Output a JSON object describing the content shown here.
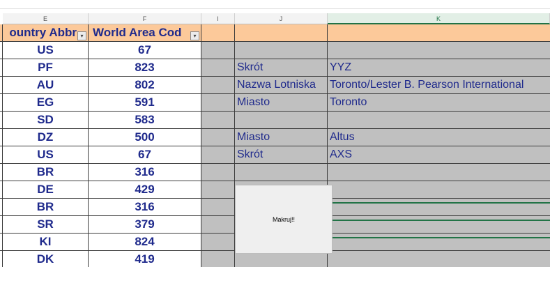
{
  "columns": [
    "E",
    "F",
    "I",
    "J",
    "K"
  ],
  "headers": {
    "country_abbr": "ountry Abbr",
    "world_area_code": "World Area Cod",
    "filter_glyph": "▾"
  },
  "rows": [
    {
      "e": "US",
      "f": "67",
      "j": "",
      "k": ""
    },
    {
      "e": "PF",
      "f": "823",
      "j": "Skrót",
      "k": "YYZ"
    },
    {
      "e": "AU",
      "f": "802",
      "j": "Nazwa Lotniska",
      "k": "Toronto/Lester B. Pearson International"
    },
    {
      "e": "EG",
      "f": "591",
      "j": "Miasto",
      "k": "Toronto"
    },
    {
      "e": "SD",
      "f": "583",
      "j": "",
      "k": ""
    },
    {
      "e": "DZ",
      "f": "500",
      "j": "Miasto",
      "k": "Altus"
    },
    {
      "e": "US",
      "f": "67",
      "j": "Skrót",
      "k": "AXS"
    },
    {
      "e": "BR",
      "f": "316",
      "j": "",
      "k": ""
    },
    {
      "e": "DE",
      "f": "429",
      "j": "",
      "k": ""
    },
    {
      "e": "BR",
      "f": "316",
      "j": "",
      "k": ""
    },
    {
      "e": "SR",
      "f": "379",
      "j": "",
      "k": ""
    },
    {
      "e": "KI",
      "f": "824",
      "j": "",
      "k": ""
    },
    {
      "e": "DK",
      "f": "419",
      "j": "",
      "k": ""
    }
  ],
  "macro_button": {
    "label": "Makruj!!"
  },
  "colors": {
    "header_fill": "#fcc99a",
    "gray_fill": "#c0c0c0",
    "text_blue": "#1f2a8c",
    "selection_green": "#217346"
  }
}
